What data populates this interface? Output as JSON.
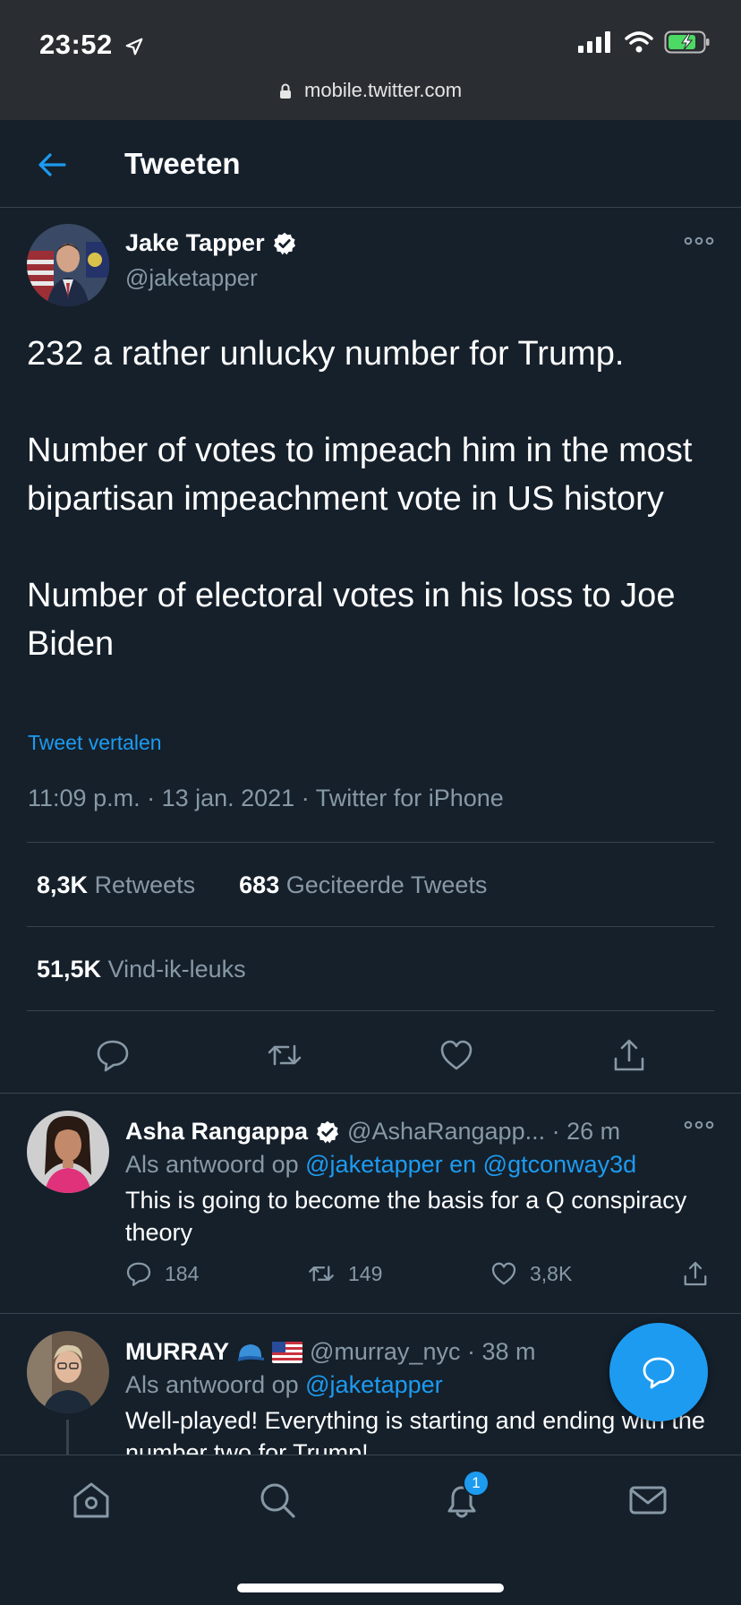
{
  "status_bar": {
    "time": "23:52",
    "url": "mobile.twitter.com"
  },
  "header": {
    "title": "Tweeten"
  },
  "tweet": {
    "author_name": "Jake Tapper",
    "author_handle": "@jaketapper",
    "text": "232 a rather unlucky number for Trump.\n\nNumber of votes to impeach him in the most bipartisan impeachment vote in US history\n\nNumber of electoral votes in his loss to Joe Biden",
    "translate_label": "Tweet vertalen",
    "meta": "11:09 p.m. · 13 jan. 2021 · Twitter for iPhone",
    "retweets_count": "8,3K",
    "retweets_label": "Retweets",
    "quotes_count": "683",
    "quotes_label": "Geciteerde Tweets",
    "likes_count": "51,5K",
    "likes_label": "Vind-ik-leuks"
  },
  "replies": [
    {
      "name": "Asha Rangappa",
      "handle": "@AshaRangapp... · 26 m",
      "reply_prefix": "Als antwoord op",
      "reply_to": "@jaketapper en @gtconway3d",
      "text": "This is going to become the basis for a Q conspiracy theory",
      "reply_count": "184",
      "retweet_count": "149",
      "like_count": "3,8K"
    },
    {
      "name": "MURRAY",
      "handle": "@murray_nyc · 38 m",
      "reply_prefix": "Als antwoord op",
      "reply_to": "@jaketapper",
      "text": "Well-played! Everything is starting and ending with the number two for Trump!"
    }
  ],
  "bottom_nav": {
    "notifications_badge": "1"
  },
  "colors": {
    "background": "#15202b",
    "accent": "#1d9bf0",
    "muted": "#8899a6",
    "border": "#38444d"
  },
  "icons": [
    "location-arrow-icon",
    "signal-icon",
    "wifi-icon",
    "battery-icon",
    "lock-icon",
    "back-arrow-icon",
    "verified-badge-icon",
    "more-icon",
    "reply-icon",
    "retweet-icon",
    "like-icon",
    "share-icon",
    "compose-icon",
    "home-icon",
    "search-icon",
    "bell-icon",
    "mail-icon"
  ]
}
